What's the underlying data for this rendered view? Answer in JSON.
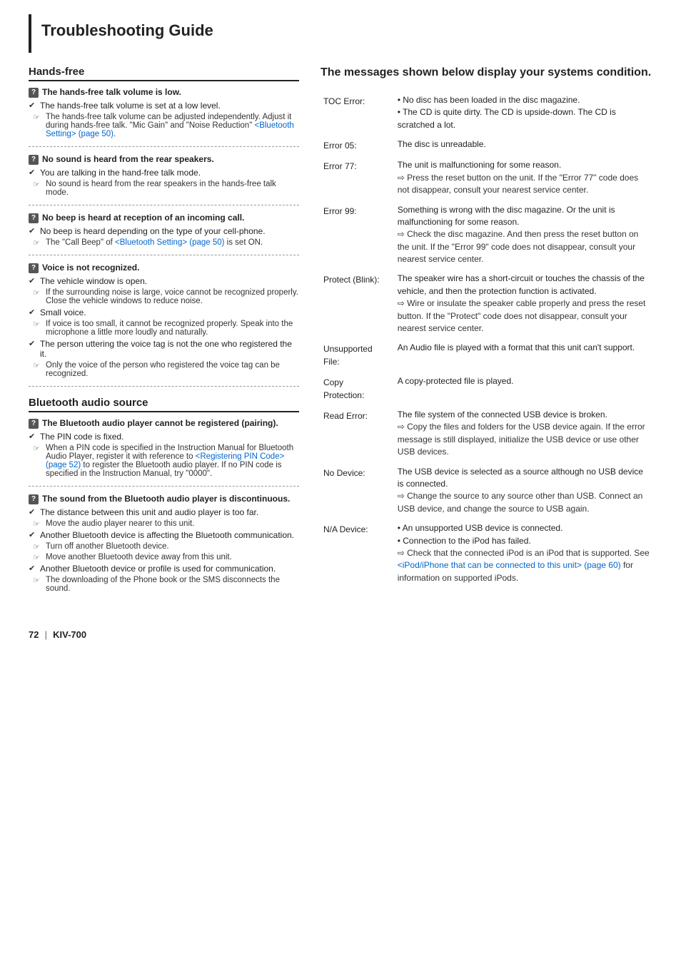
{
  "page": {
    "title": "Troubleshooting Guide",
    "footer_page": "72",
    "footer_model": "KIV-700"
  },
  "left_col": {
    "sections": [
      {
        "id": "hands-free",
        "title": "Hands-free",
        "questions": [
          {
            "id": "hf1",
            "icon": "?",
            "title": "The hands-free talk volume is low.",
            "bullets": [
              {
                "type": "check",
                "text": "The hands-free talk volume is set at a low level."
              },
              {
                "type": "note",
                "text": "The hands-free talk volume can be adjusted independently. Adjust it during hands-free talk. \"Mic Gain\" and \"Noise Reduction\" <Bluetooth Setting> (page 50).",
                "has_link": true,
                "link_text": "<Bluetooth Setting> (page 50)",
                "link_start": 89,
                "link_end": 116
              }
            ]
          },
          {
            "id": "hf2",
            "icon": "?",
            "title": "No sound is heard from the rear speakers.",
            "bullets": [
              {
                "type": "check",
                "text": "You are talking in the hand-free talk mode."
              },
              {
                "type": "note",
                "text": "No sound is heard from the rear speakers in the hands-free talk mode."
              }
            ]
          },
          {
            "id": "hf3",
            "icon": "?",
            "title": "No beep is heard at reception of an incoming call.",
            "bullets": [
              {
                "type": "check",
                "text": "No beep is heard depending on the type of your cell-phone."
              },
              {
                "type": "note",
                "text": "The \"Call Beep\" of <Bluetooth Setting> (page 50) is set ON.",
                "has_link": true,
                "link_text": "<Bluetooth Setting> (page 50)",
                "link_start": 15,
                "link_end": 44
              }
            ]
          },
          {
            "id": "hf4",
            "icon": "?",
            "title": "Voice is not recognized.",
            "sub_bullets": [
              {
                "type": "check",
                "text": "The vehicle window is open."
              },
              {
                "type": "note",
                "text": "If the surrounding noise is large, voice cannot be recognized properly. Close the vehicle windows to reduce noise."
              },
              {
                "type": "check",
                "text": "Small voice."
              },
              {
                "type": "note",
                "text": "If voice is too small, it cannot be recognized properly. Speak into the microphone a little more loudly and naturally."
              },
              {
                "type": "check",
                "text": "The person uttering the voice tag is not the one who registered the it."
              },
              {
                "type": "note",
                "text": "Only the voice of the person who registered the voice tag can be recognized."
              }
            ]
          }
        ]
      },
      {
        "id": "bluetooth-audio",
        "title": "Bluetooth audio source",
        "questions": [
          {
            "id": "bt1",
            "icon": "?",
            "title": "The Bluetooth audio player cannot be registered (pairing).",
            "bullets": [
              {
                "type": "check",
                "text": "The PIN code is fixed."
              },
              {
                "type": "note",
                "text": "When a PIN code is specified in the Instruction Manual for Bluetooth Audio Player, register it with reference to <Registering PIN Code> (page 52) to register the Bluetooth audio player. If no PIN code is specified in the Instruction Manual, try \"0000\".",
                "has_link": true,
                "link_text": "<Registering PIN Code> (page 52)",
                "link_start": 73,
                "link_end": 106
              }
            ]
          },
          {
            "id": "bt2",
            "icon": "?",
            "title": "The sound from the Bluetooth audio player is discontinuous.",
            "bullets": [
              {
                "type": "check",
                "text": "The distance between this unit and audio player is too far."
              },
              {
                "type": "note",
                "text": "Move the audio player nearer to this unit."
              },
              {
                "type": "check",
                "text": "Another Bluetooth device is affecting the Bluetooth communication."
              },
              {
                "type": "note",
                "text": "Turn off another Bluetooth device."
              },
              {
                "type": "note",
                "text": "Move another Bluetooth device away from this unit."
              },
              {
                "type": "check",
                "text": "Another Bluetooth device or profile is used for communication."
              },
              {
                "type": "note",
                "text": "The downloading of the Phone book or the SMS disconnects the sound."
              }
            ]
          }
        ]
      }
    ]
  },
  "right_col": {
    "section_title": "The messages shown below display your systems condition.",
    "errors": [
      {
        "id": "toc-error",
        "code": "TOC Error:",
        "messages": [
          "• No disc has been loaded in the disc magazine.",
          "• The CD is quite dirty. The CD is upside-down. The CD is scratched a lot."
        ],
        "actions": []
      },
      {
        "id": "error05",
        "code": "Error 05:",
        "messages": [
          "The disc is unreadable."
        ],
        "actions": []
      },
      {
        "id": "error77",
        "code": "Error 77:",
        "messages": [
          "The unit is malfunctioning for some reason."
        ],
        "actions": [
          "Press the reset button on the unit. If the \"Error 77\" code does not disappear, consult your nearest service center."
        ]
      },
      {
        "id": "error99",
        "code": "Error 99:",
        "messages": [
          "Something is wrong with the disc magazine. Or the unit is malfunctioning for some reason."
        ],
        "actions": [
          "Check the disc magazine. And then press the reset button on the unit. If the \"Error 99\" code does not disappear, consult your nearest service center."
        ]
      },
      {
        "id": "protect-blink",
        "code": "Protect (Blink):",
        "messages": [
          "The speaker wire has a short-circuit or touches the chassis of the vehicle, and then the protection function is activated."
        ],
        "actions": [
          "Wire or insulate the speaker cable properly and press the reset button. If the \"Protect\" code does not disappear, consult your nearest service center."
        ]
      },
      {
        "id": "unsupported-file",
        "code": "Unsupported File:",
        "messages": [
          "An Audio file is played with a format that this unit can't support."
        ],
        "actions": []
      },
      {
        "id": "copy-protection",
        "code": "Copy Protection:",
        "messages": [
          "A copy-protected file is played."
        ],
        "actions": []
      },
      {
        "id": "read-error",
        "code": "Read Error:",
        "messages": [
          "The file system of the connected USB device is broken."
        ],
        "actions": [
          "Copy the files and folders for the USB device again. If the error message is still displayed, initialize the USB device or use other USB devices."
        ]
      },
      {
        "id": "no-device",
        "code": "No Device:",
        "messages": [
          "The USB device is selected as a source although no USB device is connected."
        ],
        "actions": [
          "Change the source to any source other than USB. Connect an USB device, and change the source to USB again."
        ]
      },
      {
        "id": "na-device",
        "code": "N/A Device:",
        "messages": [
          "• An unsupported USB device is connected.",
          "• Connection to the iPod has failed."
        ],
        "actions": [
          "Check that the connected iPod is an iPod that is supported. See <iPod/iPhone that can be connected to this unit> (page 60) for information on supported iPods."
        ],
        "action_has_link": true,
        "action_link_text": "<iPod/iPhone that can be connected to this unit> (page 60)"
      }
    ]
  }
}
